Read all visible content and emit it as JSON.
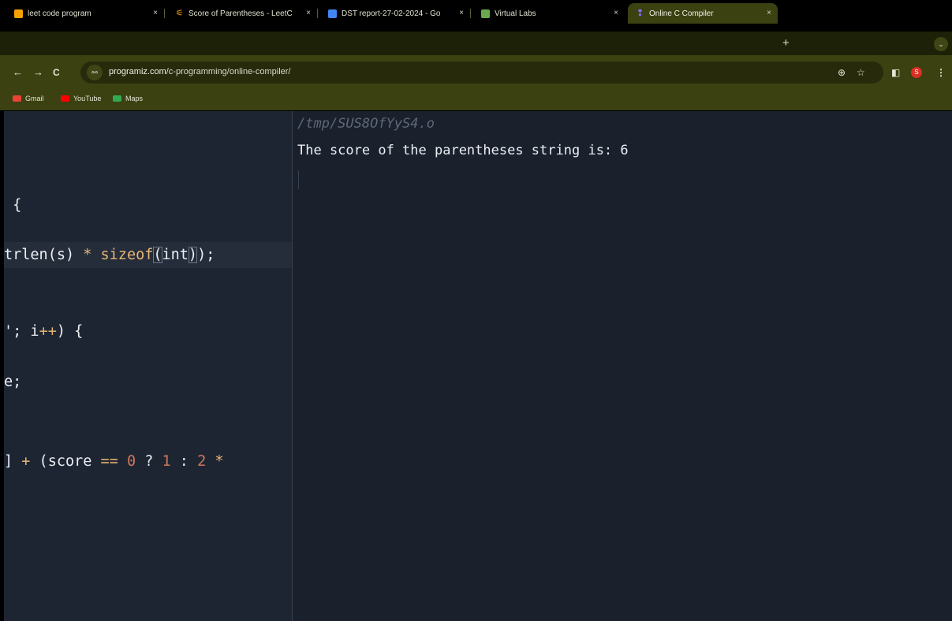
{
  "browser": {
    "tabs": [
      {
        "title": "leet code program",
        "close": "×",
        "favicon_color": "#f4a100",
        "active": false
      },
      {
        "title": "Score of Parentheses - LeetC",
        "close": "×",
        "favicon_color": "#ffa116",
        "active": false
      },
      {
        "title": "DST report-27-02-2024 - Go",
        "close": "×",
        "favicon_color": "#4285f4",
        "active": false
      },
      {
        "title": "Virtual Labs",
        "close": "×",
        "favicon_color": "#6aa84f",
        "active": false
      },
      {
        "title": "Online C Compiler",
        "close": "×",
        "favicon_color": "#7b5cff",
        "active": true
      }
    ],
    "new_tab": "+",
    "tab_menu": "⌄",
    "nav": {
      "back": "←",
      "forward": "→",
      "reload": "C"
    },
    "site_info_icon": "⚯",
    "url_host": "programiz.com",
    "url_path": "/c-programming/online-compiler/",
    "toolbar_icons": {
      "zoom": "⊕",
      "bookmark_star": "☆",
      "sidepanel": "◧",
      "menu": "⋮"
    },
    "profile_initial": "S",
    "bookmarks": [
      {
        "label": "Gmail",
        "color": "#ea4335"
      },
      {
        "label": "YouTube",
        "color": "#ff0000"
      },
      {
        "label": "Maps",
        "color": "#34a853"
      }
    ]
  },
  "editor": {
    "line1": " {",
    "line2": {
      "a": "trlen(s) ",
      "star": "*",
      "b": " ",
      "fn": "sizeof",
      "lp": "(",
      "kw": "int",
      "rp": ")",
      "end": ");"
    },
    "line3": {
      "a": "'; i",
      "inc": "++",
      "b": ") {"
    },
    "line4": "e;",
    "line5": {
      "a": "] ",
      "plus": "+",
      "b": " (score ",
      "eq": "==",
      "c": " ",
      "n0": "0",
      "d": " ? ",
      "n1": "1",
      "e": " : ",
      "n2": "2",
      "f": " ",
      "star": "*"
    }
  },
  "terminal": {
    "path": "/tmp/SUS8OfYyS4.o",
    "output": "The score of the parentheses string is: 6"
  }
}
